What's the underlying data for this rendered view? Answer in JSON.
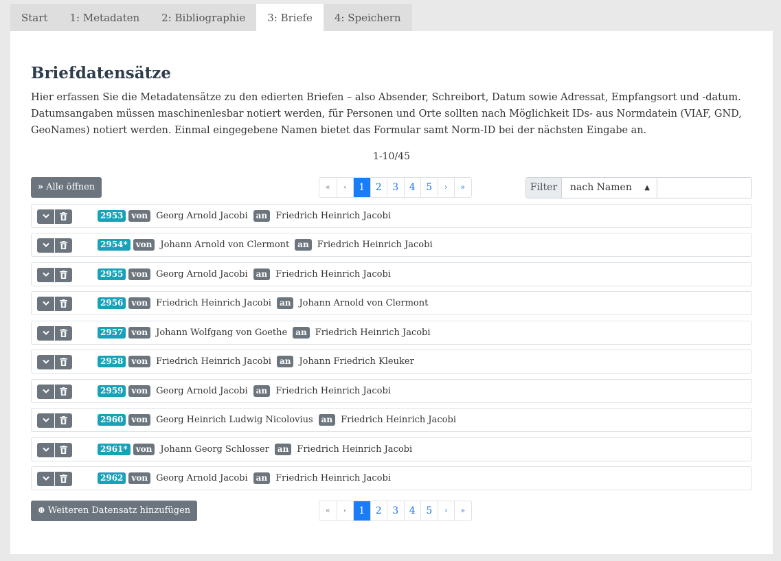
{
  "tabs": [
    {
      "label": "Start",
      "active": false
    },
    {
      "label": "1: Metadaten",
      "active": false
    },
    {
      "label": "2: Bibliographie",
      "active": false
    },
    {
      "label": "3: Briefe",
      "active": true
    },
    {
      "label": "4: Speichern",
      "active": false
    }
  ],
  "main": {
    "title": "Briefdatensätze",
    "intro_line1": "Hier erfassen Sie die Metadatensätze zu den edierten Briefen – also Absender, Schreibort, Datum sowie Adressat, Empfangsort und -datum.",
    "intro_line2": "Datumsangaben müssen maschinenlesbar notiert werden, für Personen und Orte sollten nach Möglichkeit IDs- aus Normdatein (VIAF, GND,",
    "intro_line3": "GeoNames) notiert werden. Einmal eingegebene Namen bietet das Formular samt Norm-ID bei der nächsten Eingabe an.",
    "range": "1-10/45",
    "open_all_label": "Alle öffnen",
    "add_label": "Weiteren Datensatz hinzufügen"
  },
  "pagination": {
    "first": "«",
    "prev": "‹",
    "pages": [
      "1",
      "2",
      "3",
      "4",
      "5"
    ],
    "active_page": "1",
    "next": "›",
    "last": "»"
  },
  "filter": {
    "label": "Filter",
    "selected": "nach Namen",
    "input_value": ""
  },
  "labels": {
    "from": "von",
    "to": "an"
  },
  "letters": [
    {
      "id": "2953",
      "from": "Georg Arnold Jacobi",
      "to": "Friedrich Heinrich Jacobi"
    },
    {
      "id": "2954*",
      "from": "Johann Arnold von Clermont",
      "to": "Friedrich Heinrich Jacobi"
    },
    {
      "id": "2955",
      "from": "Georg Arnold Jacobi",
      "to": "Friedrich Heinrich Jacobi"
    },
    {
      "id": "2956",
      "from": "Friedrich Heinrich Jacobi",
      "to": "Johann Arnold von Clermont"
    },
    {
      "id": "2957",
      "from": "Johann Wolfgang von Goethe",
      "to": "Friedrich Heinrich Jacobi"
    },
    {
      "id": "2958",
      "from": "Friedrich Heinrich Jacobi",
      "to": "Johann Friedrich Kleuker"
    },
    {
      "id": "2959",
      "from": "Georg Arnold Jacobi",
      "to": "Friedrich Heinrich Jacobi"
    },
    {
      "id": "2960",
      "from": "Georg Heinrich Ludwig Nicolovius",
      "to": "Friedrich Heinrich Jacobi"
    },
    {
      "id": "2961*",
      "from": "Johann Georg Schlosser",
      "to": "Friedrich Heinrich Jacobi"
    },
    {
      "id": "2962",
      "from": "Georg Arnold Jacobi",
      "to": "Friedrich Heinrich Jacobi"
    }
  ],
  "icons": {
    "expand": "chevron-down-icon",
    "delete": "trash-icon",
    "open_all": "double-chevron-right-icon",
    "add": "plus-circle-icon",
    "select_arrow": "sort-arrows-icon"
  },
  "colors": {
    "id_badge": "#17a2b8",
    "label_badge": "#6c757d",
    "active_page": "#1a7cf6"
  }
}
